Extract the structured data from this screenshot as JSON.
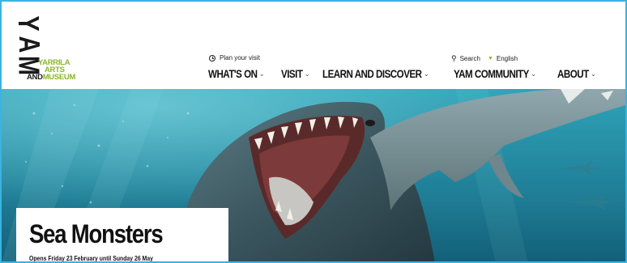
{
  "logo": {
    "mark": [
      "Y",
      "A",
      "M"
    ],
    "line1": "YARRILA",
    "line2": "ARTS",
    "line3_a": "AND",
    "line3_b": "MUSEUM"
  },
  "utility": {
    "plan_visit": "Plan your visit",
    "search": "Search",
    "language": "English"
  },
  "nav": [
    {
      "label": "WHAT'S ON"
    },
    {
      "label": "VISIT"
    },
    {
      "label": "LEARN AND DISCOVER"
    },
    {
      "label": "YAM COMMUNITY"
    },
    {
      "label": "ABOUT"
    }
  ],
  "hero": {
    "title": "Sea Monsters",
    "subtitle": "Opens Friday 23 February until Sunday 26 May"
  },
  "colors": {
    "accent_green": "#8ab62b",
    "frame_blue": "#3bb3e0",
    "sea": "#2b8fa6"
  },
  "icons": {
    "clock": "clock-icon",
    "search": "search-icon",
    "language": "triangle-down-icon",
    "nav_dropdown": "chevron-down-icon"
  }
}
